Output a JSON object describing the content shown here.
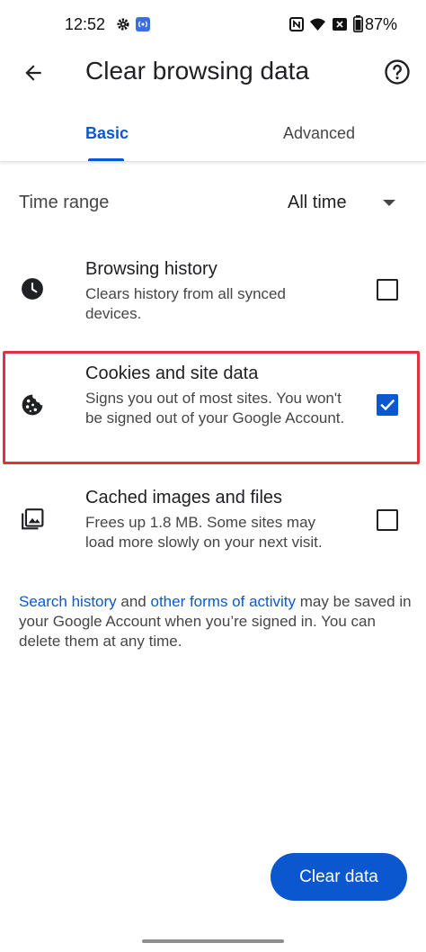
{
  "status_bar": {
    "time": "12:52",
    "battery_percent": "87%"
  },
  "app_bar": {
    "title": "Clear browsing data",
    "back_icon": "arrow-back-icon",
    "help_icon": "help-circle-icon"
  },
  "tabs": [
    {
      "label": "Basic",
      "selected": true
    },
    {
      "label": "Advanced",
      "selected": false
    }
  ],
  "time_range": {
    "label": "Time range",
    "value": "All time"
  },
  "options": [
    {
      "icon": "clock-icon",
      "title": "Browsing history",
      "description": "Clears history from all synced devices.",
      "checked": false
    },
    {
      "icon": "cookie-icon",
      "title": "Cookies and site data",
      "description": "Signs you out of most sites. You won't be signed out of your Google Account.",
      "checked": true
    },
    {
      "icon": "image-icon",
      "title": "Cached images and files",
      "description": "Frees up 1.8 MB. Some sites may load more slowly on your next visit.",
      "checked": false
    }
  ],
  "footer": {
    "link1": "Search history",
    "text1": " and ",
    "link2": "other forms of activity",
    "text2": " may be saved in your Google Account when you’re signed in. You can delete them at any time."
  },
  "clear_button": {
    "label": "Clear data"
  },
  "colors": {
    "accent": "#0b57d0",
    "highlight_border": "#e5303d"
  }
}
